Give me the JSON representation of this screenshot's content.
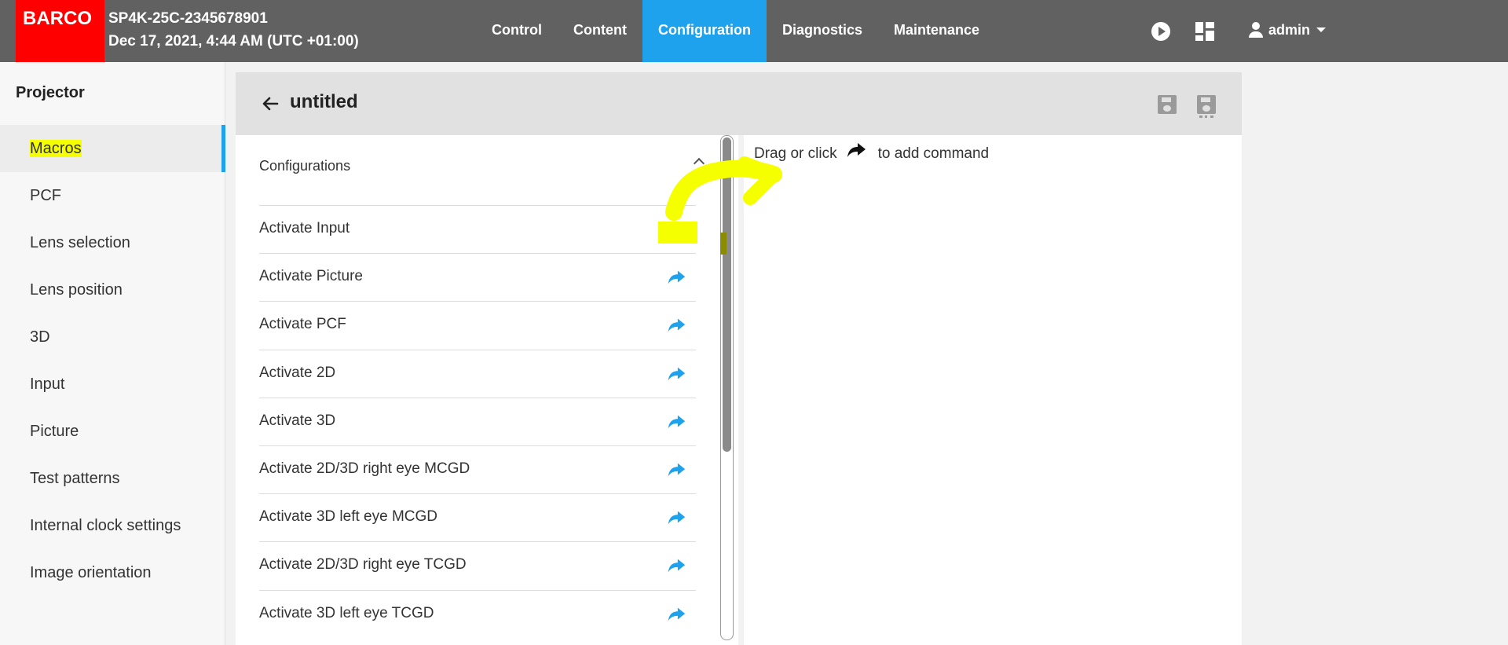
{
  "brand": {
    "logo_text": "BARCO",
    "accent": "#1ea2ee",
    "logo_bg": "#ff0000"
  },
  "header": {
    "device_id": "SP4K-25C-2345678901",
    "datetime": "Dec 17, 2021, 4:44 AM (UTC +01:00)",
    "nav": [
      {
        "label": "Control",
        "active": false
      },
      {
        "label": "Content",
        "active": false
      },
      {
        "label": "Configuration",
        "active": true
      },
      {
        "label": "Diagnostics",
        "active": false
      },
      {
        "label": "Maintenance",
        "active": false
      }
    ],
    "icons": [
      "play-icon",
      "dashboard-icon",
      "user-icon"
    ],
    "user": "admin"
  },
  "sidebar": {
    "title": "Projector",
    "items": [
      {
        "label": "Macros",
        "active": true
      },
      {
        "label": "PCF"
      },
      {
        "label": "Lens selection"
      },
      {
        "label": "Lens position"
      },
      {
        "label": "3D"
      },
      {
        "label": "Input"
      },
      {
        "label": "Picture"
      },
      {
        "label": "Test patterns"
      },
      {
        "label": "Internal clock settings"
      },
      {
        "label": "Image orientation"
      }
    ]
  },
  "main": {
    "title": "untitled",
    "section": "Configurations",
    "commands": [
      "Activate Input",
      "Activate Picture",
      "Activate PCF",
      "Activate 2D",
      "Activate 3D",
      "Activate 2D/3D right eye MCGD",
      "Activate 3D left eye MCGD",
      "Activate 2D/3D right eye TCGD",
      "Activate 3D left eye TCGD"
    ],
    "hint_before": "Drag or click",
    "hint_after": "to add command"
  }
}
